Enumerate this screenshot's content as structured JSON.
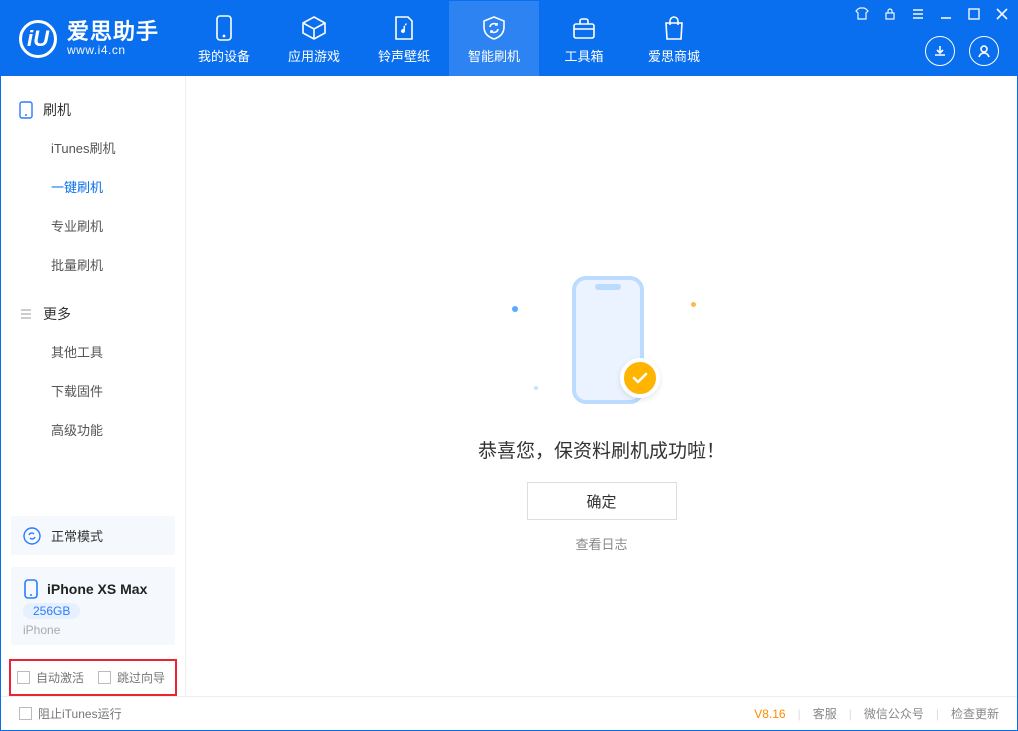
{
  "app": {
    "name_cn": "爱思助手",
    "name_en": "www.i4.cn",
    "logo_letter": "iU"
  },
  "nav": {
    "items": [
      {
        "label": "我的设备"
      },
      {
        "label": "应用游戏"
      },
      {
        "label": "铃声壁纸"
      },
      {
        "label": "智能刷机"
      },
      {
        "label": "工具箱"
      },
      {
        "label": "爱思商城"
      }
    ]
  },
  "sidebar": {
    "group1": {
      "title": "刷机",
      "items": [
        "iTunes刷机",
        "一键刷机",
        "专业刷机",
        "批量刷机"
      ]
    },
    "group2": {
      "title": "更多",
      "items": [
        "其他工具",
        "下载固件",
        "高级功能"
      ]
    },
    "mode": "正常模式",
    "device": {
      "name": "iPhone XS Max",
      "storage": "256GB",
      "type": "iPhone"
    },
    "checks": {
      "auto_activate": "自动激活",
      "skip_guide": "跳过向导"
    }
  },
  "main": {
    "success_text": "恭喜您，保资料刷机成功啦！",
    "ok_button": "确定",
    "view_log": "查看日志"
  },
  "footer": {
    "block_itunes": "阻止iTunes运行",
    "version": "V8.16",
    "links": [
      "客服",
      "微信公众号",
      "检查更新"
    ]
  }
}
